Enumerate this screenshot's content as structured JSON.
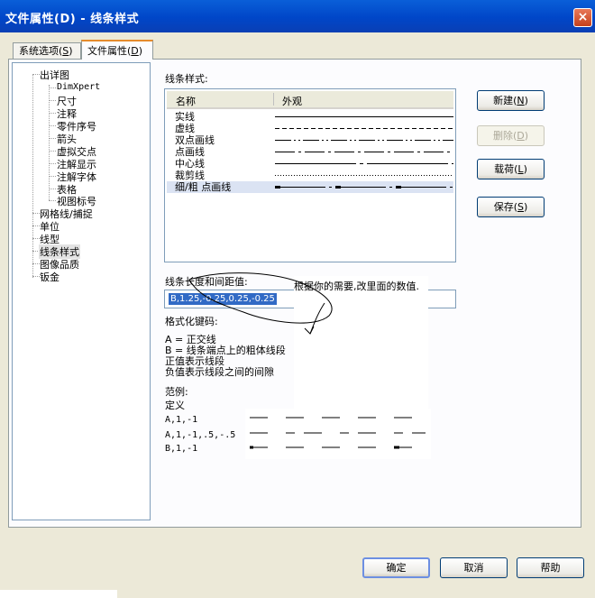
{
  "window": {
    "title": "文件属性(D) - 线条样式",
    "close_symbol": "×"
  },
  "tabs": [
    {
      "label": "系统选项",
      "key": "S",
      "active": false
    },
    {
      "label": "文件属性",
      "key": "D",
      "active": true
    }
  ],
  "tree": {
    "items": [
      {
        "label": "出详图",
        "level": 1
      },
      {
        "label": "DimXpert",
        "level": 2
      },
      {
        "label": "尺寸",
        "level": 2
      },
      {
        "label": "注释",
        "level": 2
      },
      {
        "label": "零件序号",
        "level": 2
      },
      {
        "label": "箭头",
        "level": 2
      },
      {
        "label": "虚拟交点",
        "level": 2
      },
      {
        "label": "注解显示",
        "level": 2
      },
      {
        "label": "注解字体",
        "level": 2
      },
      {
        "label": "表格",
        "level": 2
      },
      {
        "label": "视图标号",
        "level": 2
      },
      {
        "label": "网格线/捕捉",
        "level": 1
      },
      {
        "label": "单位",
        "level": 1
      },
      {
        "label": "线型",
        "level": 1
      },
      {
        "label": "线条样式",
        "level": 1,
        "selected": true
      },
      {
        "label": "图像品质",
        "level": 1
      },
      {
        "label": "钣金",
        "level": 1
      }
    ]
  },
  "line_styles": {
    "section_label": "线条样式:",
    "columns": {
      "name": "名称",
      "appearance": "外观"
    },
    "rows": [
      {
        "name": "实线",
        "pattern": "solid"
      },
      {
        "name": "虚线",
        "pattern": "dashed"
      },
      {
        "name": "双点画线",
        "pattern": "phantom"
      },
      {
        "name": "点画线",
        "pattern": "dashdot"
      },
      {
        "name": "中心线",
        "pattern": "center"
      },
      {
        "name": "裁剪线",
        "pattern": "dotted"
      },
      {
        "name": "细/粗 点画线",
        "pattern": "thickthin",
        "selected": true
      }
    ]
  },
  "buttons": {
    "new": {
      "label": "新建",
      "key": "N"
    },
    "delete": {
      "label": "删除",
      "key": "D"
    },
    "load": {
      "label": "载荷",
      "key": "L"
    },
    "save": {
      "label": "保存",
      "key": "S"
    },
    "ok": "确定",
    "cancel": "取消",
    "help": "帮助"
  },
  "spacing": {
    "label": "线条长度和间距值:",
    "value": "B,1.25,-0.25,0.25,-0.25",
    "annotation": "根据你的需要,改里面的数值."
  },
  "format_codes": {
    "title": "格式化键码:",
    "lines": [
      "A = 正交线",
      "B = 线条端点上的粗体线段",
      "正值表示线段",
      "负值表示线段之间的间隙"
    ]
  },
  "examples": {
    "title": "范例:",
    "definition_label": "定义",
    "rows": [
      {
        "code": "A,1,-1"
      },
      {
        "code": "A,1,-1,.5,-.5"
      },
      {
        "code": "B,1,-1"
      }
    ]
  },
  "colors": {
    "title_bar": "#0046c8",
    "dialog_bg": "#ece9d8",
    "selection": "#316ac5",
    "tab_highlight": "#e68b2c"
  }
}
